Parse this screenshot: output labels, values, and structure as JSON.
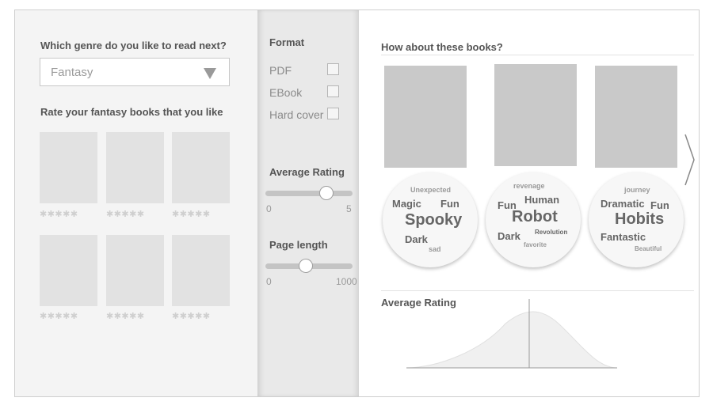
{
  "left": {
    "genre_question": "Which genre do you like to read next?",
    "genre_selected": "Fantasy",
    "rate_heading": "Rate your fantasy books that you like",
    "stars": "✱✱✱✱✱"
  },
  "filters": {
    "format_title": "Format",
    "formats": [
      "PDF",
      "EBook",
      "Hard cover"
    ],
    "avg_rating_title": "Average Rating",
    "avg_rating_min": "0",
    "avg_rating_max": "5",
    "avg_rating_level": 0.7,
    "page_length_title": "Page length",
    "page_length_min": "0",
    "page_length_max": "1000",
    "page_length_level": 0.46
  },
  "recommendations": {
    "title": "How about these books?",
    "clouds": [
      {
        "words": [
          "Unexpected",
          "Magic",
          "Fun",
          "Spooky",
          "Dark",
          "sad"
        ]
      },
      {
        "words": [
          "revenage",
          "Fun",
          "Human",
          "Robot",
          "Dark",
          "Revolution",
          "favorite"
        ]
      },
      {
        "words": [
          "journey",
          "Dramatic",
          "Fun",
          "Hobits",
          "Fantastic",
          "Beautiful"
        ]
      }
    ],
    "next_icon": "chevron-right-icon",
    "avg_rating_title": "Average Rating"
  },
  "colors": {
    "panel_left": "#f4f4f4",
    "panel_mid": "#e9e9e9",
    "placeholder": "#e2e2e2",
    "rec_placeholder": "#c9c9c9"
  }
}
